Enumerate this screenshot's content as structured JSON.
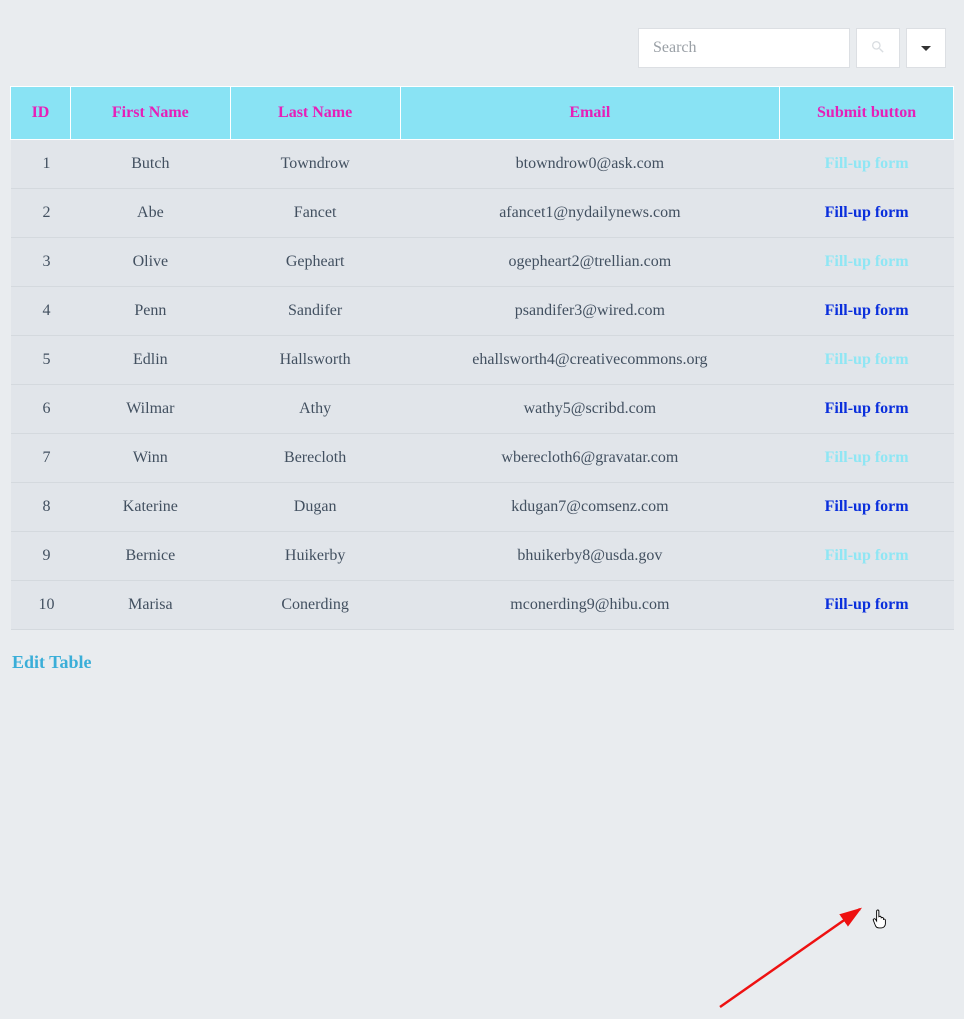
{
  "search": {
    "placeholder": "Search"
  },
  "columns": {
    "id": "ID",
    "first": "First Name",
    "last": "Last Name",
    "email": "Email",
    "submit": "Submit button"
  },
  "rows": [
    {
      "id": "1",
      "first": "Butch",
      "last": "Towndrow",
      "email": "btowndrow0@ask.com",
      "link": "Fill-up form",
      "style": "light"
    },
    {
      "id": "2",
      "first": "Abe",
      "last": "Fancet",
      "email": "afancet1@nydailynews.com",
      "link": "Fill-up form",
      "style": "dark"
    },
    {
      "id": "3",
      "first": "Olive",
      "last": "Gepheart",
      "email": "ogepheart2@trellian.com",
      "link": "Fill-up form",
      "style": "light"
    },
    {
      "id": "4",
      "first": "Penn",
      "last": "Sandifer",
      "email": "psandifer3@wired.com",
      "link": "Fill-up form",
      "style": "dark"
    },
    {
      "id": "5",
      "first": "Edlin",
      "last": "Hallsworth",
      "email": "ehallsworth4@creativecommons.org",
      "link": "Fill-up form",
      "style": "light"
    },
    {
      "id": "6",
      "first": "Wilmar",
      "last": "Athy",
      "email": "wathy5@scribd.com",
      "link": "Fill-up form",
      "style": "dark"
    },
    {
      "id": "7",
      "first": "Winn",
      "last": "Berecloth",
      "email": "wberecloth6@gravatar.com",
      "link": "Fill-up form",
      "style": "light"
    },
    {
      "id": "8",
      "first": "Katerine",
      "last": "Dugan",
      "email": "kdugan7@comsenz.com",
      "link": "Fill-up form",
      "style": "dark"
    },
    {
      "id": "9",
      "first": "Bernice",
      "last": "Huikerby",
      "email": "bhuikerby8@usda.gov",
      "link": "Fill-up form",
      "style": "light"
    },
    {
      "id": "10",
      "first": "Marisa",
      "last": "Conerding",
      "email": "mconerding9@hibu.com",
      "link": "Fill-up form",
      "style": "dark"
    }
  ],
  "footer": {
    "edit": "Edit Table"
  }
}
